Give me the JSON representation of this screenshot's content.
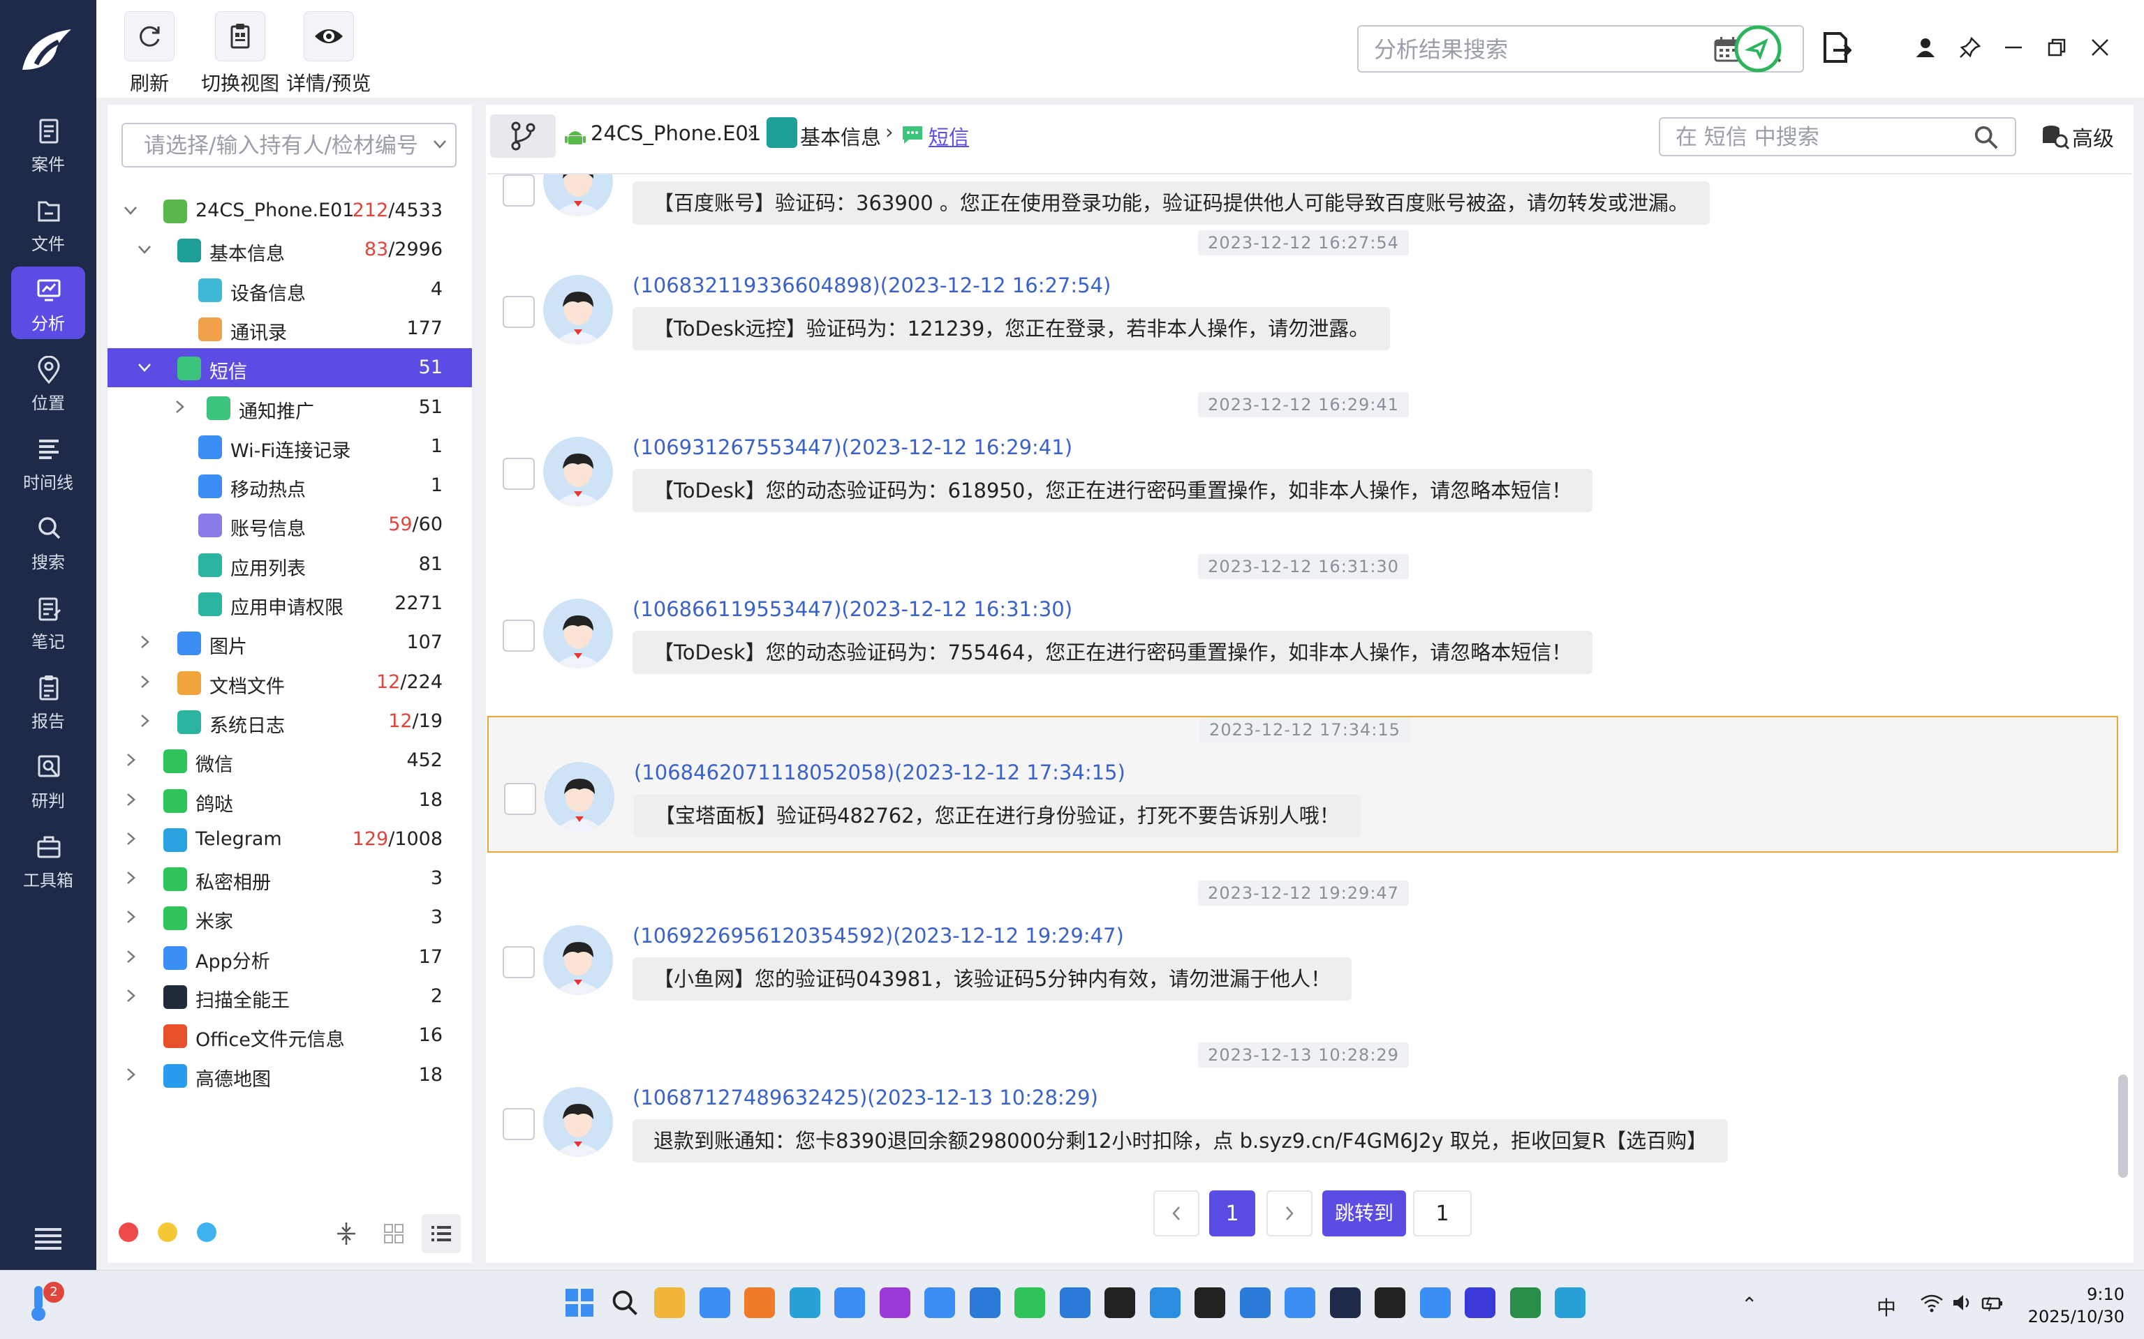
{
  "nav": {
    "items": [
      {
        "label": "案件",
        "icon": "case-icon"
      },
      {
        "label": "文件",
        "icon": "folder-icon"
      },
      {
        "label": "分析",
        "icon": "analysis-icon",
        "active": true
      },
      {
        "label": "位置",
        "icon": "location-icon"
      },
      {
        "label": "时间线",
        "icon": "timeline-icon"
      },
      {
        "label": "搜索",
        "icon": "search-icon"
      },
      {
        "label": "笔记",
        "icon": "notes-icon"
      },
      {
        "label": "报告",
        "icon": "report-icon"
      },
      {
        "label": "研判",
        "icon": "research-icon"
      },
      {
        "label": "工具箱",
        "icon": "toolbox-icon"
      }
    ]
  },
  "toolbar": {
    "refresh_label": "刷新",
    "switch_view_label": "切换视图",
    "detail_preview_label": "详情/预览",
    "search_placeholder": "分析结果搜索"
  },
  "tree": {
    "holder_placeholder": "请选择/输入持有人/检材编号",
    "items": [
      {
        "label": "24CS_Phone.E01",
        "count_red": "212",
        "count_rest": "/4533",
        "icon_color": "#58b84a"
      },
      {
        "label": "基本信息",
        "count_red": "83",
        "count_rest": "/2996",
        "icon_color": "#1d9e96"
      },
      {
        "label": "设备信息",
        "count_red": "",
        "count_rest": "4",
        "icon_color": "#3fb8d6"
      },
      {
        "label": "通讯录",
        "count_red": "",
        "count_rest": "177",
        "icon_color": "#f3a04b"
      },
      {
        "label": "短信",
        "count_red": "",
        "count_rest": "51",
        "icon_color": "#3cc47c"
      },
      {
        "label": "通知推广",
        "count_red": "",
        "count_rest": "51",
        "icon_color": "#3cc47c"
      },
      {
        "label": "Wi-Fi连接记录",
        "count_red": "",
        "count_rest": "1",
        "icon_color": "#3a8ef6"
      },
      {
        "label": "移动热点",
        "count_red": "",
        "count_rest": "1",
        "icon_color": "#3a8ef6"
      },
      {
        "label": "账号信息",
        "count_red": "59",
        "count_rest": "/60",
        "icon_color": "#8a7ce8"
      },
      {
        "label": "应用列表",
        "count_red": "",
        "count_rest": "81",
        "icon_color": "#2bb5a0"
      },
      {
        "label": "应用申请权限",
        "count_red": "",
        "count_rest": "2271",
        "icon_color": "#2bb5a0"
      },
      {
        "label": "图片",
        "count_red": "",
        "count_rest": "107",
        "icon_color": "#3a8ef6"
      },
      {
        "label": "文档文件",
        "count_red": "12",
        "count_rest": "/224",
        "icon_color": "#f0a43a"
      },
      {
        "label": "系统日志",
        "count_red": "12",
        "count_rest": "/19",
        "icon_color": "#2bb5a0"
      },
      {
        "label": "微信",
        "count_red": "",
        "count_rest": "452",
        "icon_color": "#2ec45a"
      },
      {
        "label": "鸽哒",
        "count_red": "",
        "count_rest": "18",
        "icon_color": "#2ec45a"
      },
      {
        "label": "Telegram",
        "count_red": "129",
        "count_rest": "/1008",
        "icon_color": "#2aa3e0"
      },
      {
        "label": "私密相册",
        "count_red": "",
        "count_rest": "3",
        "icon_color": "#2ec45a"
      },
      {
        "label": "米家",
        "count_red": "",
        "count_rest": "3",
        "icon_color": "#2ec45a"
      },
      {
        "label": "App分析",
        "count_red": "",
        "count_rest": "17",
        "icon_color": "#3a8ef6"
      },
      {
        "label": "扫描全能王",
        "count_red": "",
        "count_rest": "2",
        "icon_color": "#1f2a3a"
      },
      {
        "label": "Office文件元信息",
        "count_red": "",
        "count_rest": "16",
        "icon_color": "#e8502a"
      },
      {
        "label": "高德地图",
        "count_red": "",
        "count_rest": "18",
        "icon_color": "#2a9cf0"
      }
    ]
  },
  "breadcrumb": {
    "device": "24CS_Phone.E01",
    "category": "基本信息",
    "current": "短信",
    "search_placeholder": "在 短信 中搜索",
    "advanced_label": "高级"
  },
  "messages": [
    {
      "stamp": "",
      "sender": "",
      "text": "【百度账号】验证码：363900 。您正在使用登录功能，验证码提供他人可能导致百度账号被盗，请勿转发或泄漏。"
    },
    {
      "stamp": "2023-12-12 16:27:54",
      "sender": "(106832119336604898)(2023-12-12 16:27:54)",
      "text": "【ToDesk远控】验证码为：121239，您正在登录，若非本人操作，请勿泄露。"
    },
    {
      "stamp": "2023-12-12 16:29:41",
      "sender": "(106931267553447)(2023-12-12 16:29:41)",
      "text": "【ToDesk】您的动态验证码为：618950，您正在进行密码重置操作，如非本人操作，请忽略本短信！"
    },
    {
      "stamp": "2023-12-12 16:31:30",
      "sender": "(106866119553447)(2023-12-12 16:31:30)",
      "text": "【ToDesk】您的动态验证码为：755464，您正在进行密码重置操作，如非本人操作，请忽略本短信！"
    },
    {
      "stamp": "2023-12-12 17:34:15",
      "sender": "(1068462071118052058)(2023-12-12 17:34:15)",
      "text": "【宝塔面板】验证码482762，您正在进行身份验证，打死不要告诉别人哦！"
    },
    {
      "stamp": "2023-12-12 19:29:47",
      "sender": "(1069226956120354592)(2023-12-12 19:29:47)",
      "text": "【小鱼网】您的验证码043981，该验证码5分钟内有效，请勿泄漏于他人！"
    },
    {
      "stamp": "2023-12-13 10:28:29",
      "sender": "(10687127489632425)(2023-12-13 10:28:29)",
      "text": "退款到账通知：您卡8390退回余额298000分剩12小时扣除，点 b.syz9.cn/F4GM6J2y 取兑，拒收回复R【选百购】"
    }
  ],
  "pager": {
    "current_page": "1",
    "jump_label": "跳转到",
    "jump_value": "1"
  },
  "taskbar": {
    "badge": "2",
    "ime": "中",
    "time": "9:10",
    "date": "2025/10/30"
  },
  "colors": {
    "accent": "#5b4de3",
    "nav_bg": "#1f2a48",
    "link": "#3a62c8",
    "highlight_border": "#e8a53a",
    "red_count": "#e0453c"
  }
}
